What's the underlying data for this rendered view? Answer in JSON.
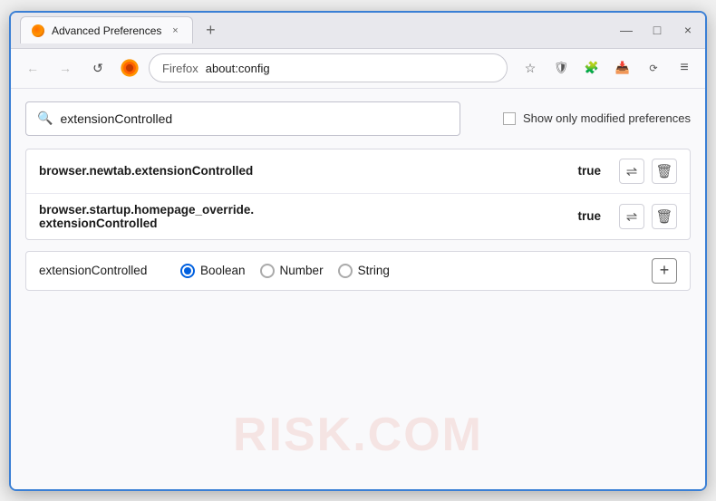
{
  "window": {
    "title": "Advanced Preferences",
    "tab_close": "×",
    "tab_new": "+",
    "win_minimize": "—",
    "win_maximize": "□",
    "win_close": "×"
  },
  "navbar": {
    "back_label": "←",
    "forward_label": "→",
    "refresh_label": "↺",
    "browser_name": "Firefox",
    "address": "about:config",
    "star_icon": "☆",
    "shield_icon": "⛉",
    "ext_icon": "🧩",
    "download_icon": "⇩",
    "sync_icon": "⟳",
    "menu_icon": "≡"
  },
  "search": {
    "placeholder": "extensionControlled",
    "value": "extensionControlled",
    "show_modified_label": "Show only modified preferences"
  },
  "results": [
    {
      "name": "browser.newtab.extensionControlled",
      "value": "true"
    },
    {
      "name": "browser.startup.homepage_override.\nextensionControlled",
      "name_line1": "browser.startup.homepage_override.",
      "name_line2": "extensionControlled",
      "value": "true"
    }
  ],
  "add_row": {
    "name": "extensionControlled",
    "types": [
      "Boolean",
      "Number",
      "String"
    ],
    "selected_type": "Boolean",
    "add_label": "+"
  },
  "watermark": "RISK.COM",
  "icons": {
    "toggle": "⇌",
    "delete": "🗑",
    "search": "🔍"
  }
}
